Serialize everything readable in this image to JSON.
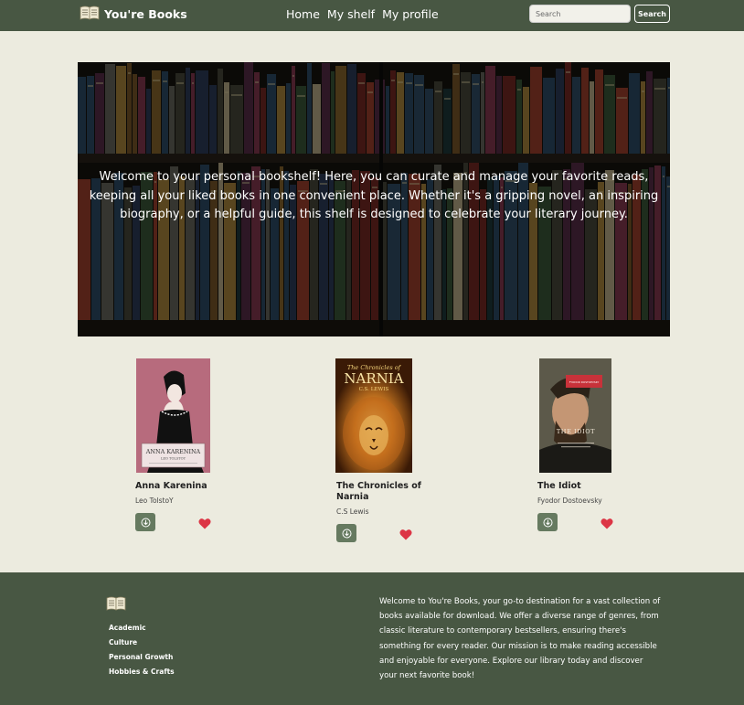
{
  "nav": {
    "brand": "You're Books",
    "links": [
      "Home",
      "My shelf",
      "My profile"
    ],
    "search_placeholder": "Search",
    "search_button": "Search"
  },
  "hero": {
    "text": "Welcome to your personal bookshelf! Here, you can curate and manage your favorite reads, keeping all your liked books in one convenient place. Whether it's a gripping novel, an inspiring biography, or a helpful guide, this shelf is designed to celebrate your literary journey."
  },
  "books": [
    {
      "title": "Anna Karenina",
      "author": "Leo TolstoY",
      "cover_text": [
        "ANNA KARENINA",
        "LEO TOLSTOY"
      ]
    },
    {
      "title": "The Chronicles of Narnia",
      "title_lines": [
        "The Chronicles of",
        "Narnia"
      ],
      "author": "C.S Lewis",
      "cover_text": [
        "The Chronicles of",
        "NARNIA",
        "C.S. LEWIS"
      ]
    },
    {
      "title": "The Idiot",
      "author": "Fyodor Dostoevsky",
      "cover_text": [
        "FYODOR DOSTOEVSKY",
        "THE IDIOT"
      ]
    }
  ],
  "footer": {
    "links": [
      "Academic",
      "Culture",
      "Personal Growth",
      "Hobbies & Crafts"
    ],
    "about": "Welcome to You're Books, your go-to destination for a vast collection of books available for download. We offer a diverse range of genres, from classic literature to contemporary bestsellers, ensuring there's something for every reader. Our mission is to make reading accessible and enjoyable for everyone. Explore our library today and discover your next favorite book!"
  },
  "colors": {
    "nav_bg": "#485743",
    "page_bg": "#ecebdf",
    "button_bg": "#667a60",
    "heart": "#dc3545"
  },
  "icons": {
    "brand": "open-book-icon",
    "download": "download-circle-icon",
    "like": "heart-icon",
    "footer": "open-book-icon"
  }
}
